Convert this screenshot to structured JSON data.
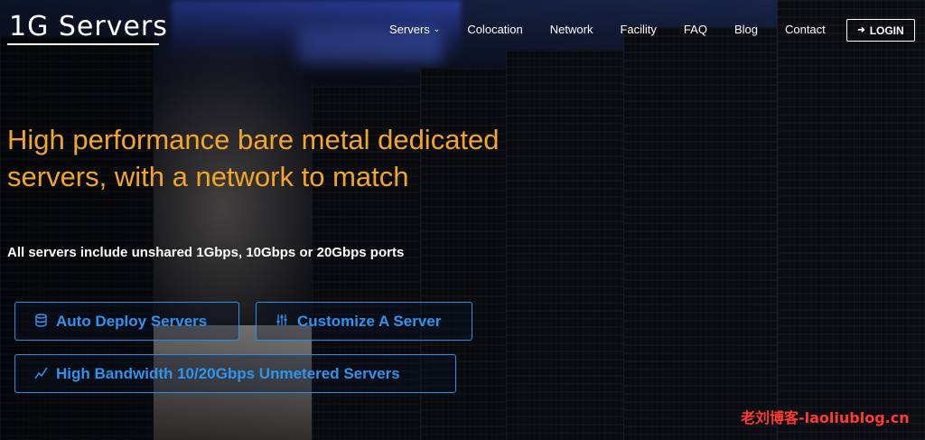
{
  "brand": {
    "logo_text": "1G Servers"
  },
  "nav": {
    "items": [
      {
        "label": "Servers",
        "has_dropdown": true
      },
      {
        "label": "Colocation"
      },
      {
        "label": "Network"
      },
      {
        "label": "Facility"
      },
      {
        "label": "FAQ"
      },
      {
        "label": "Blog"
      },
      {
        "label": "Contact"
      }
    ],
    "login_label": "LOGIN"
  },
  "hero": {
    "headline": "High performance bare metal dedicated servers, with a network to match",
    "subhead": "All servers include unshared 1Gbps, 10Gbps or 20Gbps ports",
    "buttons": [
      {
        "label": "Auto Deploy Servers",
        "icon": "database-icon"
      },
      {
        "label": "Customize A Server",
        "icon": "sliders-icon"
      },
      {
        "label": "High Bandwidth 10/20Gbps Unmetered Servers",
        "icon": "line-chart-icon"
      }
    ]
  },
  "watermark": "老刘博客-laoliublog.cn",
  "colors": {
    "accent_orange": "#f3a526",
    "button_blue": "#2e94ee"
  }
}
